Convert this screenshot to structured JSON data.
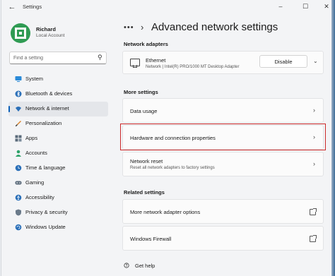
{
  "window": {
    "title": "Settings"
  },
  "user": {
    "name": "Richard",
    "account_type": "Local Account"
  },
  "search": {
    "placeholder": "Find a setting"
  },
  "nav": [
    {
      "label": "System",
      "icon": "monitor-icon"
    },
    {
      "label": "Bluetooth & devices",
      "icon": "bluetooth-icon"
    },
    {
      "label": "Network & internet",
      "icon": "wifi-icon",
      "active": true
    },
    {
      "label": "Personalization",
      "icon": "brush-icon"
    },
    {
      "label": "Apps",
      "icon": "apps-icon"
    },
    {
      "label": "Accounts",
      "icon": "person-icon"
    },
    {
      "label": "Time & language",
      "icon": "globe-clock-icon"
    },
    {
      "label": "Gaming",
      "icon": "gamepad-icon"
    },
    {
      "label": "Accessibility",
      "icon": "accessibility-icon"
    },
    {
      "label": "Privacy & security",
      "icon": "shield-icon"
    },
    {
      "label": "Windows Update",
      "icon": "update-icon"
    }
  ],
  "main": {
    "breadcrumb_dots": "•••",
    "title": "Advanced network settings",
    "network_adapters": {
      "heading": "Network adapters",
      "adapter": {
        "name": "Ethernet",
        "description": "Network | Intel(R) PRO/1000 MT Desktop Adapter",
        "button_label": "Disable"
      }
    },
    "more_settings": {
      "heading": "More settings",
      "items": [
        {
          "title": "Data usage"
        },
        {
          "title": "Hardware and connection properties"
        },
        {
          "title": "Network reset",
          "subtitle": "Reset all network adapters to factory settings"
        }
      ]
    },
    "related_settings": {
      "heading": "Related settings",
      "items": [
        {
          "title": "More network adapter options"
        },
        {
          "title": "Windows Firewall"
        }
      ]
    },
    "get_help": "Get help"
  },
  "colors": {
    "accent": "#0b5fb8",
    "highlight_border": "#cc2a2a",
    "avatar": "#2f9b53"
  }
}
